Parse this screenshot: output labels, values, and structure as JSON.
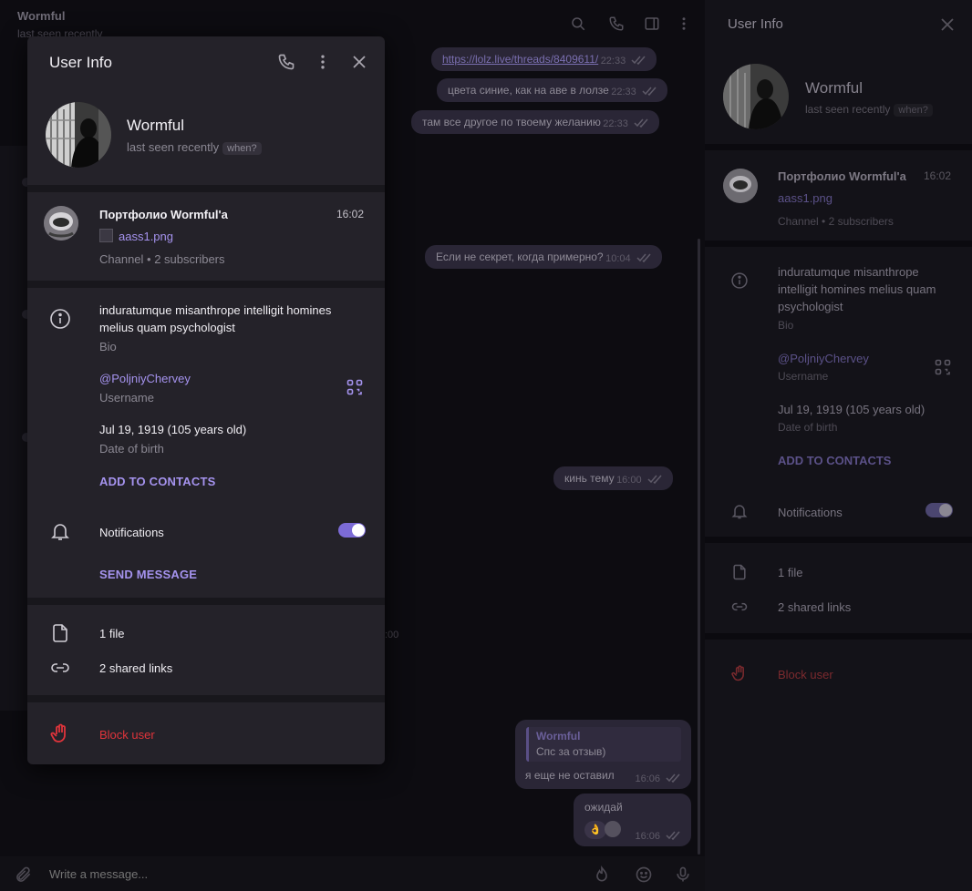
{
  "chat": {
    "title": "Wormful",
    "status": "last seen recently",
    "composer_placeholder": "Write a message...",
    "messages": [
      {
        "text": "https://lolz.live/threads/8409611/",
        "time": "22:33"
      },
      {
        "text": "цвета синие, как на аве в лолзе",
        "time": "22:33"
      },
      {
        "text": "там все другое по твоему желанию",
        "time": "22:33"
      },
      {
        "text": "Если не секрет, когда примерно?",
        "time": "10:04"
      },
      {
        "text": "кинь тему",
        "time": "16:00"
      }
    ],
    "reply_message": {
      "quote_author": "Wormful",
      "quote_text": "Спс за отзыв)",
      "text": "я еще не оставил",
      "time": "16:06"
    },
    "reaction_message": {
      "text": "ожидай",
      "emoji": "👌",
      "time": "16:06"
    },
    "partial_time": ":00"
  },
  "side_panel": {
    "title": "User Info",
    "name": "Wormful",
    "status": "last seen recently",
    "when": "when?",
    "channel": {
      "name": "Портфолио Wormful'a",
      "time": "16:02",
      "file": "aass1.png",
      "subscribers": "Channel • 2 subscribers"
    },
    "bio": "induratumque misanthrope intelligit homines melius quam psychologist",
    "bio_label": "Bio",
    "username": "@PoljniyChervey",
    "username_label": "Username",
    "birth": "Jul 19, 1919 (105 years old)",
    "birth_label": "Date of birth",
    "add_contacts": "ADD TO CONTACTS",
    "notifications": "Notifications",
    "files": "1 file",
    "links": "2 shared links",
    "block": "Block user"
  },
  "modal": {
    "title": "User Info",
    "name": "Wormful",
    "status": "last seen recently",
    "when": "when?",
    "channel": {
      "name": "Портфолио Wormful'a",
      "time": "16:02",
      "file": "aass1.png",
      "subscribers": "Channel • 2 subscribers"
    },
    "bio_line1": "induratumque misanthrope intelligit homines",
    "bio_line2": "melius quam psychologist",
    "bio_label": "Bio",
    "username": "@PoljniyChervey",
    "username_label": "Username",
    "birth": "Jul 19, 1919 (105 years old)",
    "birth_label": "Date of birth",
    "add_contacts": "ADD TO CONTACTS",
    "notifications": "Notifications",
    "notifications_on": true,
    "send_message": "SEND MESSAGE",
    "files": "1 file",
    "links": "2 shared links",
    "block": "Block user"
  },
  "colors": {
    "accent": "#a593ee",
    "danger": "#e0343b",
    "modal_bg": "#242229",
    "bubble": "#2a2636"
  },
  "icons": [
    "search-icon",
    "phone-icon",
    "sidebar-toggle-icon",
    "more-vertical-icon",
    "close-icon",
    "info-icon",
    "qr-code-icon",
    "bell-icon",
    "file-icon",
    "link-icon",
    "hand-stop-icon",
    "paperclip-icon",
    "emoji-icon",
    "microphone-icon",
    "double-check-icon"
  ]
}
